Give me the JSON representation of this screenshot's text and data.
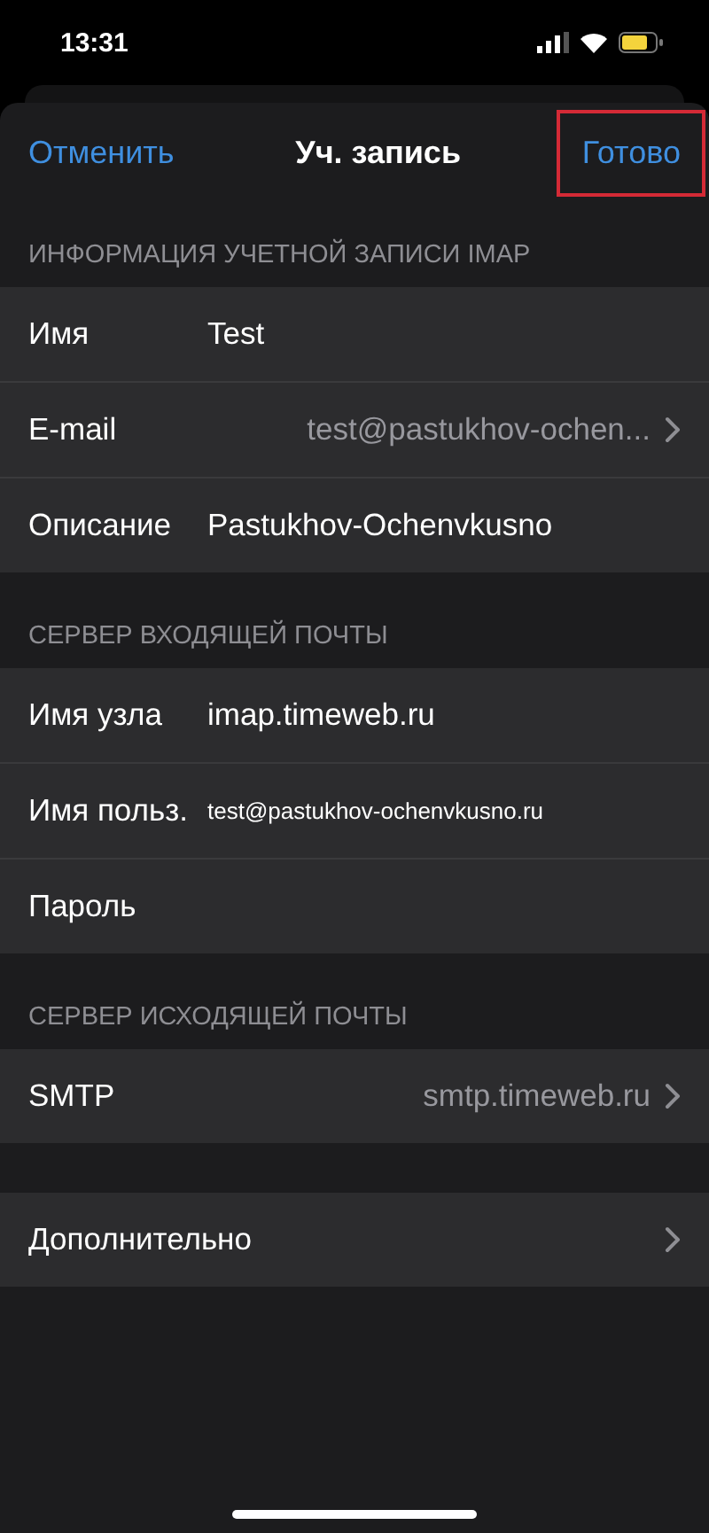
{
  "status_bar": {
    "time": "13:31"
  },
  "nav": {
    "cancel": "Отменить",
    "title": "Уч. запись",
    "done": "Готово",
    "done_highlighted": true
  },
  "sections": [
    {
      "header": "ИНФОРМАЦИЯ УЧЕТНОЙ ЗАПИСИ IMAP",
      "rows": [
        {
          "kind": "field",
          "label": "Имя",
          "value": "Test"
        },
        {
          "kind": "link",
          "label": "E-mail",
          "value": "test@pastukhov-ochen..."
        },
        {
          "kind": "field",
          "label": "Описание",
          "value": "Pastukhov-Ochenvkusno"
        }
      ]
    },
    {
      "header": "СЕРВЕР ВХОДЯЩЕЙ ПОЧТЫ",
      "rows": [
        {
          "kind": "field",
          "label": "Имя узла",
          "value": "imap.timeweb.ru"
        },
        {
          "kind": "field",
          "label": "Имя польз.",
          "value": "test@pastukhov-ochenvkusno.ru",
          "compact": true
        },
        {
          "kind": "field",
          "label": "Пароль"
        }
      ]
    },
    {
      "header": "СЕРВЕР ИСХОДЯЩЕЙ ПОЧТЫ",
      "rows": [
        {
          "kind": "link",
          "label": "SMTP",
          "value": "smtp.timeweb.ru"
        }
      ]
    },
    {
      "rows": [
        {
          "kind": "link",
          "label": "Дополнительно"
        }
      ]
    }
  ]
}
